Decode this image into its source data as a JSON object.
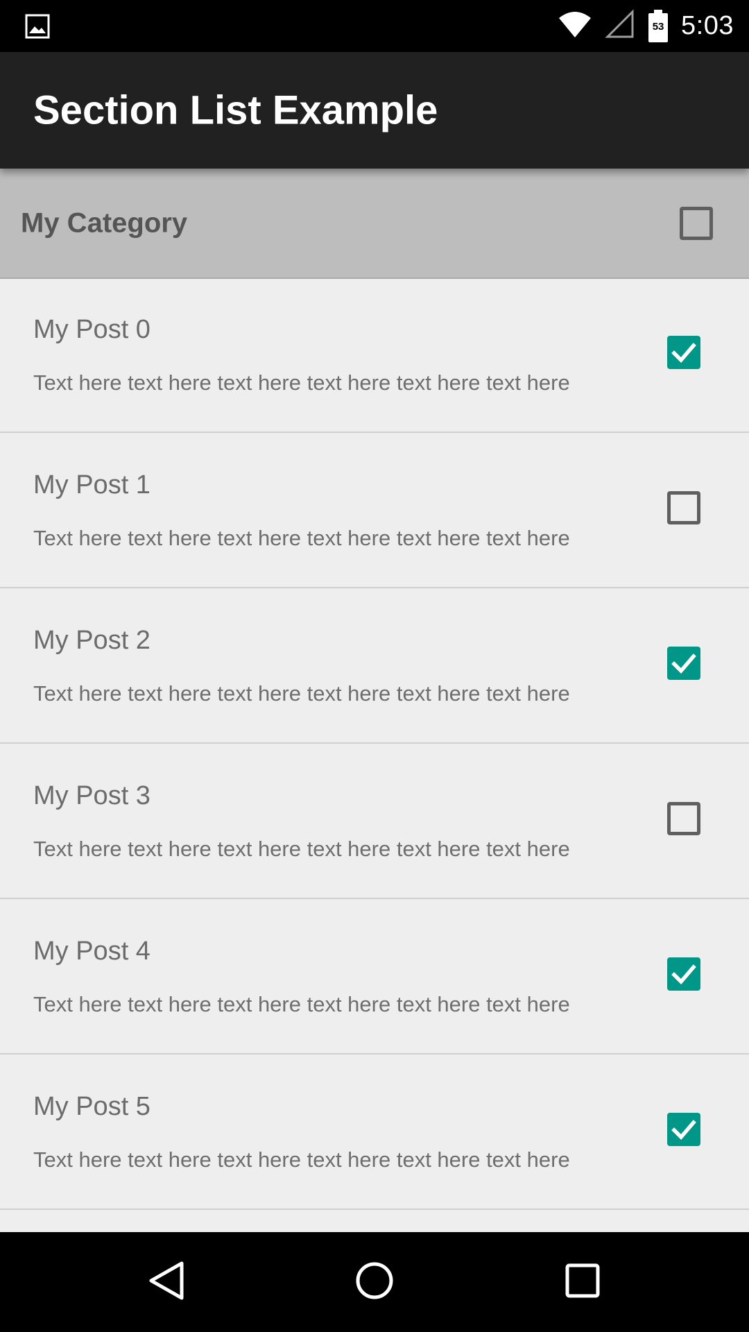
{
  "status_bar": {
    "time": "5:03",
    "battery_level": "53",
    "left_icon": "image-icon",
    "icons": [
      "wifi-icon",
      "cell-signal-icon",
      "battery-icon"
    ]
  },
  "app_bar": {
    "title": "Section List Example"
  },
  "section": {
    "title": "My Category",
    "checked": false
  },
  "items": [
    {
      "title": "My Post 0",
      "body": "Text here text here text here text here text here text here",
      "checked": true
    },
    {
      "title": "My Post 1",
      "body": "Text here text here text here text here text here text here",
      "checked": false
    },
    {
      "title": "My Post 2",
      "body": "Text here text here text here text here text here text here",
      "checked": true
    },
    {
      "title": "My Post 3",
      "body": "Text here text here text here text here text here text here",
      "checked": false
    },
    {
      "title": "My Post 4",
      "body": "Text here text here text here text here text here text here",
      "checked": true
    },
    {
      "title": "My Post 5",
      "body": "Text here text here text here text here text here text here",
      "checked": true
    }
  ],
  "nav_bar": {
    "icons": [
      "back-icon",
      "home-icon",
      "recents-icon"
    ]
  },
  "colors": {
    "accent": "#009688",
    "app_bar": "#212121",
    "section_header": "#bdbdbd",
    "background": "#eeeeee",
    "status_bar": "#000000"
  }
}
